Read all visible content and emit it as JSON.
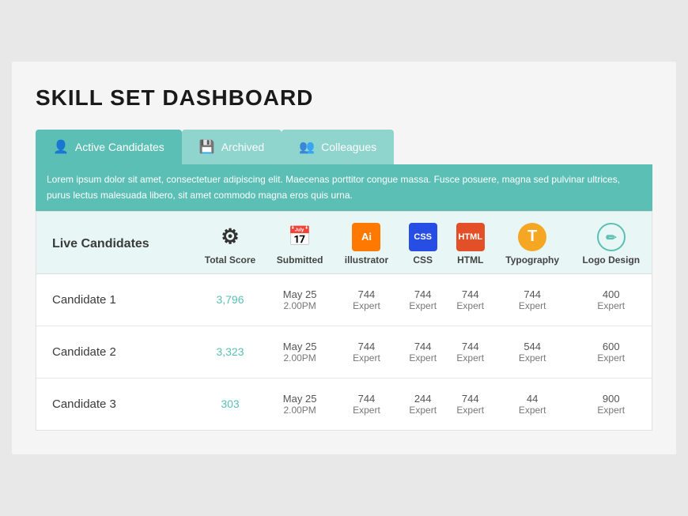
{
  "title": "Skill Set Dashboard",
  "tabs": [
    {
      "label": "Active Candidates",
      "icon": "person",
      "active": true
    },
    {
      "label": "Archived",
      "icon": "archive",
      "active": false
    },
    {
      "label": "Colleagues",
      "icon": "group",
      "active": false
    }
  ],
  "description": "Lorem ipsum dolor sit amet, consectetuer adipiscing elit. Maecenas porttitor congue massa. Fusce posuere, magna sed pulvinar ultrices, purus lectus malesuada libero, sit amet commodo magna eros quis urna.",
  "table": {
    "header": {
      "name_col": "Live Candidates",
      "columns": [
        {
          "label": "Total Score",
          "icon": "speedometer"
        },
        {
          "label": "Submitted",
          "icon": "calendar"
        },
        {
          "label": "illustrator",
          "icon": "ai"
        },
        {
          "label": "CSS",
          "icon": "css"
        },
        {
          "label": "HTML",
          "icon": "html"
        },
        {
          "label": "Typography",
          "icon": "typography"
        },
        {
          "label": "Logo Design",
          "icon": "logo"
        }
      ]
    },
    "rows": [
      {
        "name": "Candidate 1",
        "total_score": "3,796",
        "submitted_line1": "May 25",
        "submitted_line2": "2.00PM",
        "illustrator_score": "744",
        "illustrator_level": "Expert",
        "css_score": "744",
        "css_level": "Expert",
        "html_score": "744",
        "html_level": "Expert",
        "typography_score": "744",
        "typography_level": "Expert",
        "logo_score": "400",
        "logo_level": "Expert"
      },
      {
        "name": "Candidate 2",
        "total_score": "3,323",
        "submitted_line1": "May 25",
        "submitted_line2": "2.00PM",
        "illustrator_score": "744",
        "illustrator_level": "Expert",
        "css_score": "744",
        "css_level": "Expert",
        "html_score": "744",
        "html_level": "Expert",
        "typography_score": "544",
        "typography_level": "Expert",
        "logo_score": "600",
        "logo_level": "Expert"
      },
      {
        "name": "Candidate 3",
        "total_score": "303",
        "submitted_line1": "May 25",
        "submitted_line2": "2.00PM",
        "illustrator_score": "744",
        "illustrator_level": "Expert",
        "css_score": "244",
        "css_level": "Expert",
        "html_score": "744",
        "html_level": "Expert",
        "typography_score": "44",
        "typography_level": "Expert",
        "logo_score": "900",
        "logo_level": "Expert"
      }
    ]
  }
}
